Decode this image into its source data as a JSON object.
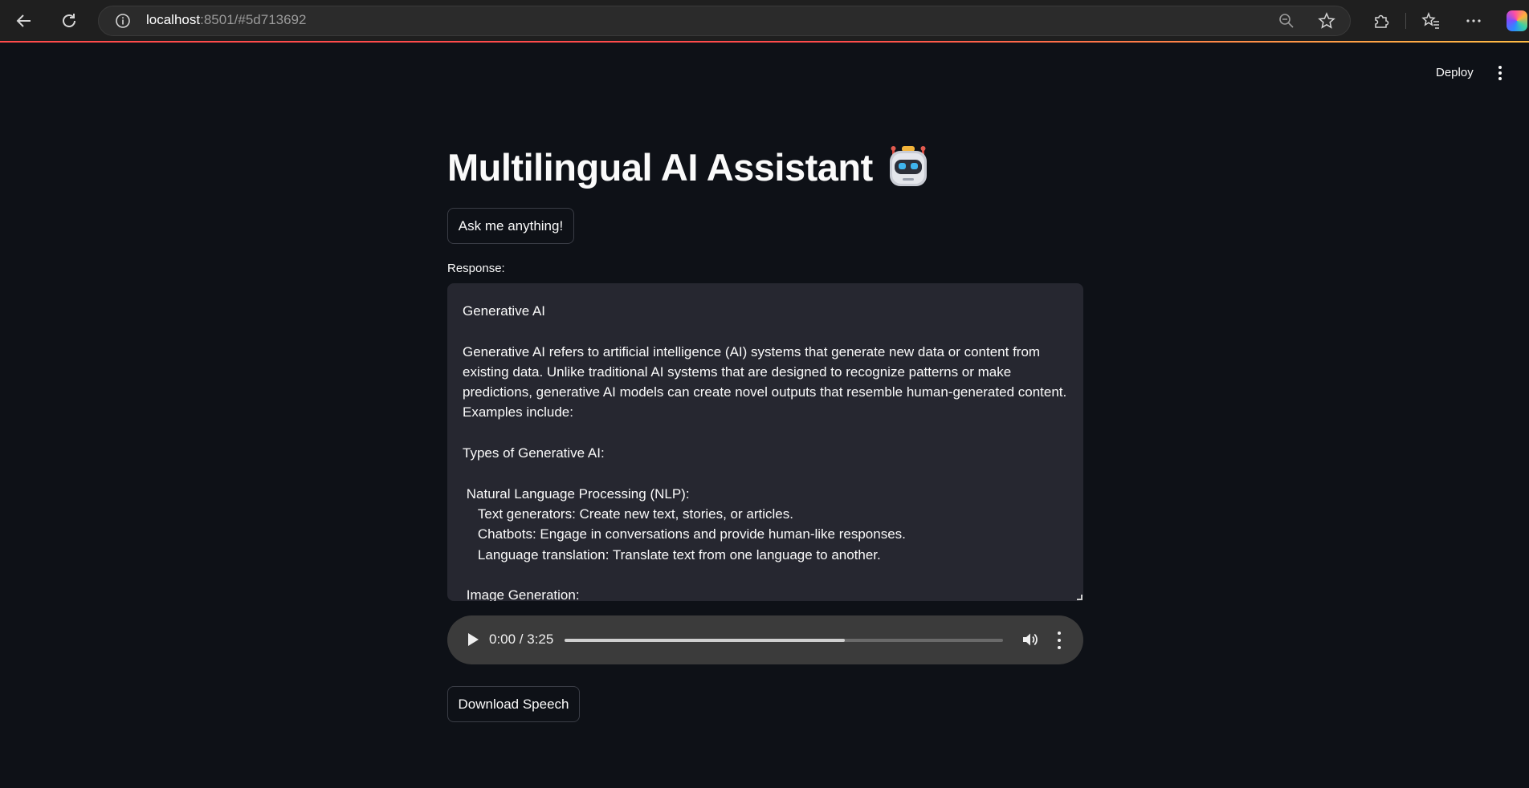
{
  "browser": {
    "url_host": "localhost",
    "url_rest": ":8501/#5d713692"
  },
  "header": {
    "deploy_label": "Deploy"
  },
  "main": {
    "title": "Multilingual AI Assistant",
    "ask_button_label": "Ask me anything!",
    "response_label": "Response:",
    "response_text": "Generative AI\n\nGenerative AI refers to artificial intelligence (AI) systems that generate new data or content from existing data. Unlike traditional AI systems that are designed to recognize patterns or make predictions, generative AI models can create novel outputs that resemble human-generated content. Examples include:\n\nTypes of Generative AI:\n\n Natural Language Processing (NLP):\n    Text generators: Create new text, stories, or articles.\n    Chatbots: Engage in conversations and provide human-like responses.\n    Language translation: Translate text from one language to another.\n\n Image Generation:",
    "audio": {
      "time_display": "0:00 / 3:25",
      "progress_fraction": 0.64
    },
    "download_button_label": "Download Speech"
  },
  "icons": {
    "back": "back-arrow-icon",
    "reload": "reload-icon",
    "site_info": "info-icon",
    "zoom": "zoom-out-icon",
    "favorite": "star-icon",
    "extensions": "puzzle-icon",
    "favorites_bar": "favorites-icon",
    "settings_more": "more-horizontal-icon",
    "copilot": "copilot-icon",
    "title_emoji": "robot-icon"
  },
  "colors": {
    "background": "#0e1117",
    "text_area": "#262730",
    "accent": "#ff4b4b"
  }
}
